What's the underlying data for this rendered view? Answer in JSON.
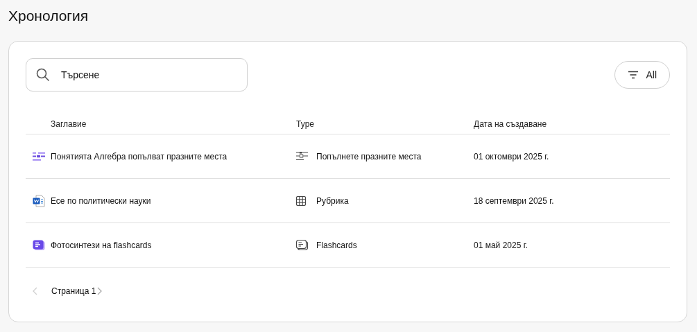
{
  "page_title": "Хронология",
  "search": {
    "value": "Търсене"
  },
  "filter": {
    "label": "All"
  },
  "table": {
    "columns": [
      "Заглавие",
      "Type",
      "Дата на създаване"
    ],
    "rows": [
      {
        "kind": "fill-blanks",
        "title": "Понятията Алгебра попълват празните места",
        "type": "Попълнете празните места",
        "date": "01 октомври 2025 г."
      },
      {
        "kind": "essay",
        "title": "Есе по политически науки",
        "type": "Рубрика",
        "date": "18 септември 2025 г."
      },
      {
        "kind": "flashcards",
        "title": "Фотосинтези на flashcards",
        "type": "Flashcards",
        "date": "01 май 2025 г."
      }
    ]
  },
  "pagination": {
    "label": "Страница 1",
    "prev_disabled": true
  }
}
